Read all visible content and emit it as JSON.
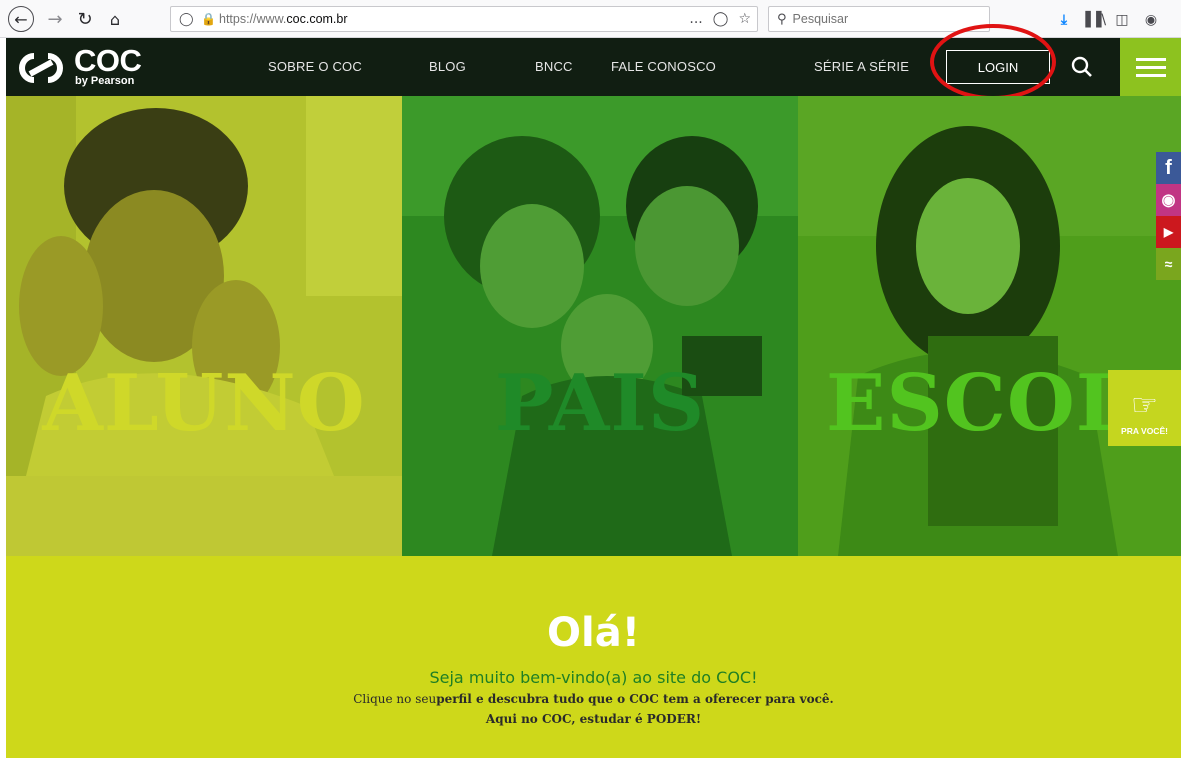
{
  "browser": {
    "url_prefix": "https://www.",
    "url_domain": "coc.com.br",
    "search_placeholder": "Pesquisar",
    "more_icon": "...",
    "back_icon": "back-icon",
    "forward_icon": "forward-icon"
  },
  "site": {
    "logo_text": "COC",
    "logo_sub": "by Pearson",
    "nav": [
      "SOBRE O COC",
      "BLOG",
      "BNCC",
      "FALE CONOSCO",
      "SÉRIE A SÉRIE"
    ],
    "login_label": "LOGIN"
  },
  "panels": {
    "aluno": "ALUNO",
    "pais": "PAIS",
    "escola": "ESCOLA"
  },
  "social": {
    "facebook": "f",
    "pra_voce": "PRA VOCÊ!"
  },
  "welcome": {
    "title": "Olá!",
    "subtitle": "Seja muito bem-vindo(a) ao site do COC!",
    "line1_a": "Clique no seu",
    "line1_b": "perfil e descubra tudo que o COC tem a oferecer para você.",
    "line2": "Aqui no COC, estudar é PODER!"
  },
  "colors": {
    "nav_bg": "#111e12",
    "accent_green": "#8dc21f",
    "welcome_bg": "#ced81a",
    "welcome_sub": "#1f7f24",
    "highlight_circle": "#e01313"
  }
}
